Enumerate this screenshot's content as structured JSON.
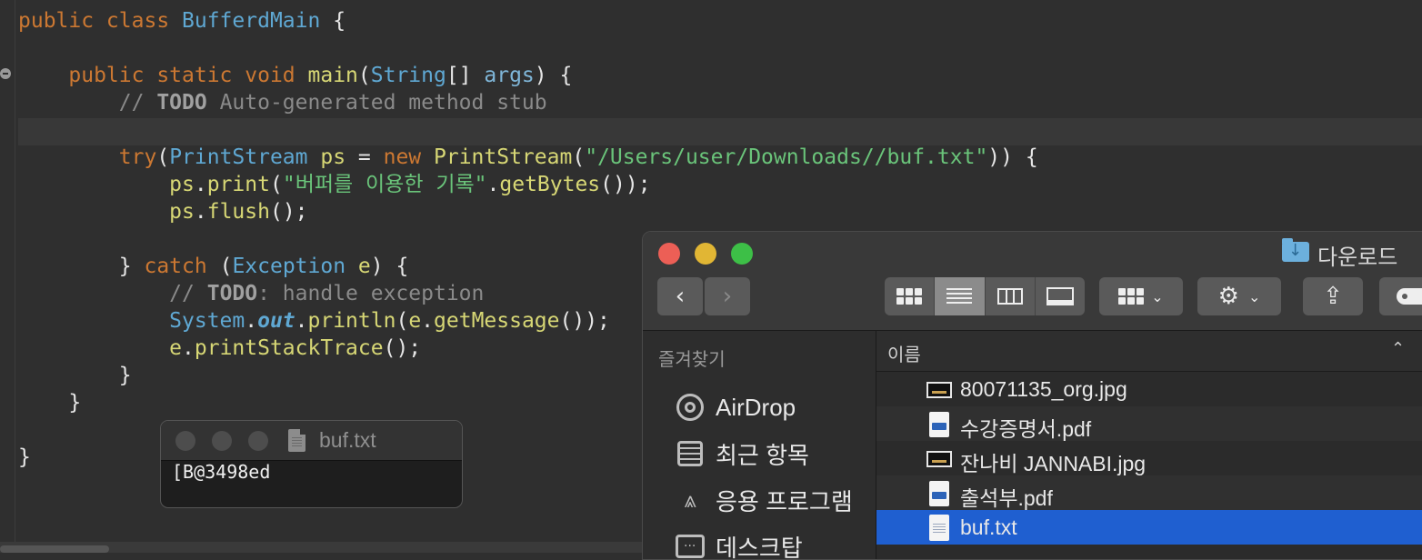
{
  "editor": {
    "lines": [
      {
        "tokens": [
          {
            "t": "public class ",
            "c": "kw"
          },
          {
            "t": "BufferdMain",
            "c": "ty"
          },
          {
            "t": " {",
            "c": "pn"
          }
        ]
      },
      {
        "tokens": []
      },
      {
        "tokens": [
          {
            "t": "    public static void ",
            "c": "kw"
          },
          {
            "t": "main",
            "c": "fn"
          },
          {
            "t": "(",
            "c": "pn"
          },
          {
            "t": "String",
            "c": "ty"
          },
          {
            "t": "[] ",
            "c": "pn"
          },
          {
            "t": "args",
            "c": "param"
          },
          {
            "t": ") {",
            "c": "pn"
          }
        ]
      },
      {
        "tokens": [
          {
            "t": "        // ",
            "c": "cm"
          },
          {
            "t": "TODO",
            "c": "cmb"
          },
          {
            "t": " Auto-generated method stub",
            "c": "cm"
          }
        ]
      },
      {
        "tokens": []
      },
      {
        "tokens": [
          {
            "t": "        try",
            "c": "kw"
          },
          {
            "t": "(",
            "c": "pn"
          },
          {
            "t": "PrintStream ",
            "c": "ty"
          },
          {
            "t": "ps",
            "c": "fn"
          },
          {
            "t": " = ",
            "c": "pn"
          },
          {
            "t": "new ",
            "c": "kw"
          },
          {
            "t": "PrintStream",
            "c": "fn"
          },
          {
            "t": "(",
            "c": "pn"
          },
          {
            "t": "\"/Users/user/Downloads//buf.txt\"",
            "c": "str"
          },
          {
            "t": ")) {",
            "c": "pn"
          }
        ]
      },
      {
        "tokens": [
          {
            "t": "            ps",
            "c": "fn"
          },
          {
            "t": ".",
            "c": "pn"
          },
          {
            "t": "print",
            "c": "fn"
          },
          {
            "t": "(",
            "c": "pn"
          },
          {
            "t": "\"버퍼를 이용한 기록\"",
            "c": "str"
          },
          {
            "t": ".",
            "c": "pn"
          },
          {
            "t": "getBytes",
            "c": "fn"
          },
          {
            "t": "());",
            "c": "pn"
          }
        ]
      },
      {
        "tokens": [
          {
            "t": "            ps",
            "c": "fn"
          },
          {
            "t": ".",
            "c": "pn"
          },
          {
            "t": "flush",
            "c": "fn"
          },
          {
            "t": "();",
            "c": "pn"
          }
        ]
      },
      {
        "tokens": []
      },
      {
        "tokens": [
          {
            "t": "        } ",
            "c": "pn"
          },
          {
            "t": "catch ",
            "c": "kw"
          },
          {
            "t": "(",
            "c": "pn"
          },
          {
            "t": "Exception ",
            "c": "ty"
          },
          {
            "t": "e",
            "c": "fn"
          },
          {
            "t": ") {",
            "c": "pn"
          }
        ]
      },
      {
        "tokens": [
          {
            "t": "            // ",
            "c": "cm"
          },
          {
            "t": "TODO",
            "c": "cmb"
          },
          {
            "t": ": handle exception",
            "c": "cm"
          }
        ]
      },
      {
        "tokens": [
          {
            "t": "            System",
            "c": "ty"
          },
          {
            "t": ".",
            "c": "pn"
          },
          {
            "t": "out",
            "c": "stat"
          },
          {
            "t": ".",
            "c": "pn"
          },
          {
            "t": "println",
            "c": "fn"
          },
          {
            "t": "(",
            "c": "pn"
          },
          {
            "t": "e",
            "c": "fn"
          },
          {
            "t": ".",
            "c": "pn"
          },
          {
            "t": "getMessage",
            "c": "fn"
          },
          {
            "t": "());",
            "c": "pn"
          }
        ]
      },
      {
        "tokens": [
          {
            "t": "            e",
            "c": "fn"
          },
          {
            "t": ".",
            "c": "pn"
          },
          {
            "t": "printStackTrace",
            "c": "fn"
          },
          {
            "t": "();",
            "c": "pn"
          }
        ]
      },
      {
        "tokens": [
          {
            "t": "        }",
            "c": "pn"
          }
        ]
      },
      {
        "tokens": [
          {
            "t": "    }",
            "c": "pn"
          }
        ]
      },
      {
        "tokens": []
      },
      {
        "tokens": [
          {
            "t": "}",
            "c": "pn"
          }
        ]
      }
    ]
  },
  "text_window": {
    "title": "buf.txt",
    "content": "[B@3498ed"
  },
  "finder": {
    "title": "다운로드",
    "sidebar_heading": "즐겨찾기",
    "sidebar_items": [
      {
        "label": "AirDrop",
        "icon": "airdrop-icon"
      },
      {
        "label": "최근 항목",
        "icon": "recents-icon"
      },
      {
        "label": "응용 프로그램",
        "icon": "applications-icon"
      },
      {
        "label": "데스크탑",
        "icon": "desktop-icon"
      }
    ],
    "column_header": "이름",
    "files": [
      {
        "name": "80071135_org.jpg",
        "type": "image"
      },
      {
        "name": "수강증명서.pdf",
        "type": "pdf"
      },
      {
        "name": "잔나비 JANNABI.jpg",
        "type": "image"
      },
      {
        "name": "출석부.pdf",
        "type": "pdf"
      },
      {
        "name": "buf.txt",
        "type": "text",
        "selected": true
      }
    ],
    "colors": {
      "selection": "#1f5fd0",
      "close": "#ec5f56",
      "minimize": "#e1b634",
      "zoom": "#3dbf47"
    }
  }
}
